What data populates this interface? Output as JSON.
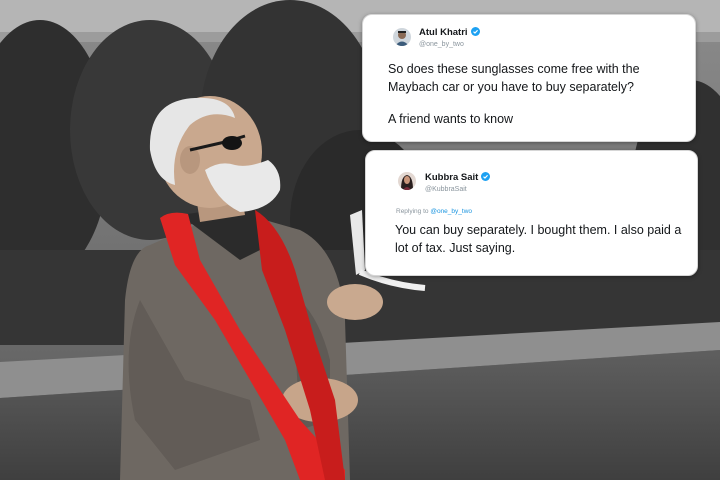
{
  "tweets": [
    {
      "name": "Atul Khatri",
      "handle": "@one_by_two",
      "verified": true,
      "text_line1": "So does these sunglasses come free with the Maybach car or you have to buy separately?",
      "text_line2": "A friend wants to know",
      "avatar_icon": "man-avatar-icon"
    },
    {
      "name": "Kubbra Sait",
      "handle": "@KubbraSait",
      "verified": true,
      "reply_prefix": "Replying to",
      "reply_to": "@one_by_two",
      "text": "You can buy separately. I bought them. I also paid a lot of tax. Just saying.",
      "avatar_icon": "woman-avatar-icon"
    }
  ],
  "colors": {
    "scarf": "#e02524",
    "verified_blue": "#1da1f2",
    "mention_blue": "#1b95e0"
  }
}
